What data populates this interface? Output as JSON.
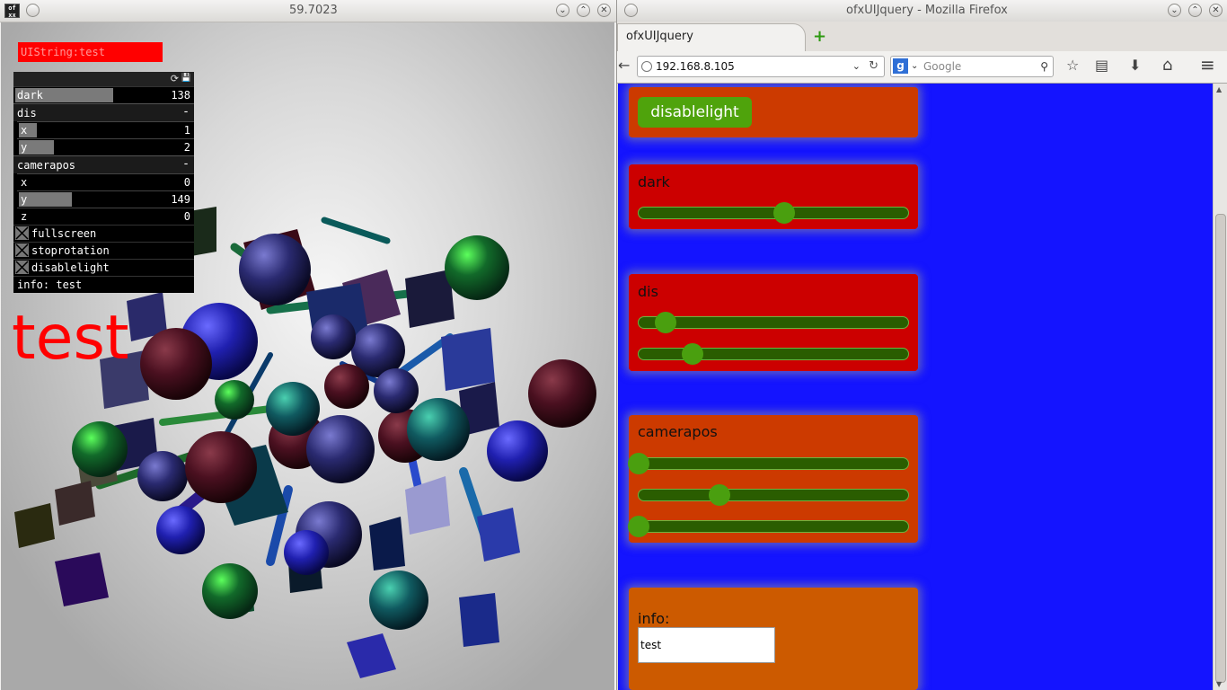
{
  "left_window": {
    "title": "59.7023",
    "app_icon_lines": [
      "of",
      "xx"
    ],
    "buttons": {
      "minimize": "⌄",
      "maximize": "⌃",
      "close": "✕"
    },
    "uistring": "UIString:test",
    "gui_header_icons": {
      "reload": "⟳",
      "save": "💾"
    },
    "gui": {
      "dark": {
        "label": "dark",
        "value": "138",
        "fraction": 0.54
      },
      "dis_group": {
        "label": "dis",
        "collapse": "-"
      },
      "dis": [
        {
          "label": "x",
          "value": "1",
          "fraction": 0.1
        },
        {
          "label": "y",
          "value": "2",
          "fraction": 0.2
        }
      ],
      "camerapos_group": {
        "label": "camerapos",
        "collapse": "-"
      },
      "camerapos": [
        {
          "label": "x",
          "value": "0",
          "fraction": 0.0
        },
        {
          "label": "y",
          "value": "149",
          "fraction": 0.3
        },
        {
          "label": "z",
          "value": "0",
          "fraction": 0.0
        }
      ],
      "toggles": [
        "fullscreen",
        "stoprotation",
        "disablelight"
      ],
      "info": "info: test"
    },
    "big_text": "test"
  },
  "right_window": {
    "title": "ofxUIJquery - Mozilla Firefox",
    "buttons": {
      "minimize": "⌄",
      "maximize": "⌃",
      "close": "✕"
    },
    "tab_label": "ofxUIJquery",
    "new_tab": "+",
    "url": "192.168.8.105",
    "search_placeholder": "Google",
    "search_engine_letter": "g",
    "toolbar_icons": {
      "back": "←",
      "dropdown": "⌄",
      "reload": "↻",
      "binoculars": "⚲",
      "bookmark": "☆",
      "reader": "▤",
      "download": "⬇",
      "home": "⌂",
      "menu": "≡"
    },
    "page": {
      "disablelight_button": "disablelight",
      "dark": {
        "title": "dark",
        "sliders": [
          0.54
        ]
      },
      "dis": {
        "title": "dis",
        "sliders": [
          0.1,
          0.2
        ]
      },
      "camerapos": {
        "title": "camerapos",
        "sliders": [
          0.0,
          0.3,
          0.0
        ]
      },
      "info": {
        "title": "info:",
        "value": "test"
      }
    },
    "colors": {
      "page_bg": "#1414ff",
      "panel_dark_red": "#cc0000",
      "panel_orange_red": "#cc3a00",
      "panel_orange": "#cc5a00",
      "slider_track": "#2a5d00",
      "slider_knob": "#4a9f0f",
      "button_green": "#4fa30c"
    }
  }
}
